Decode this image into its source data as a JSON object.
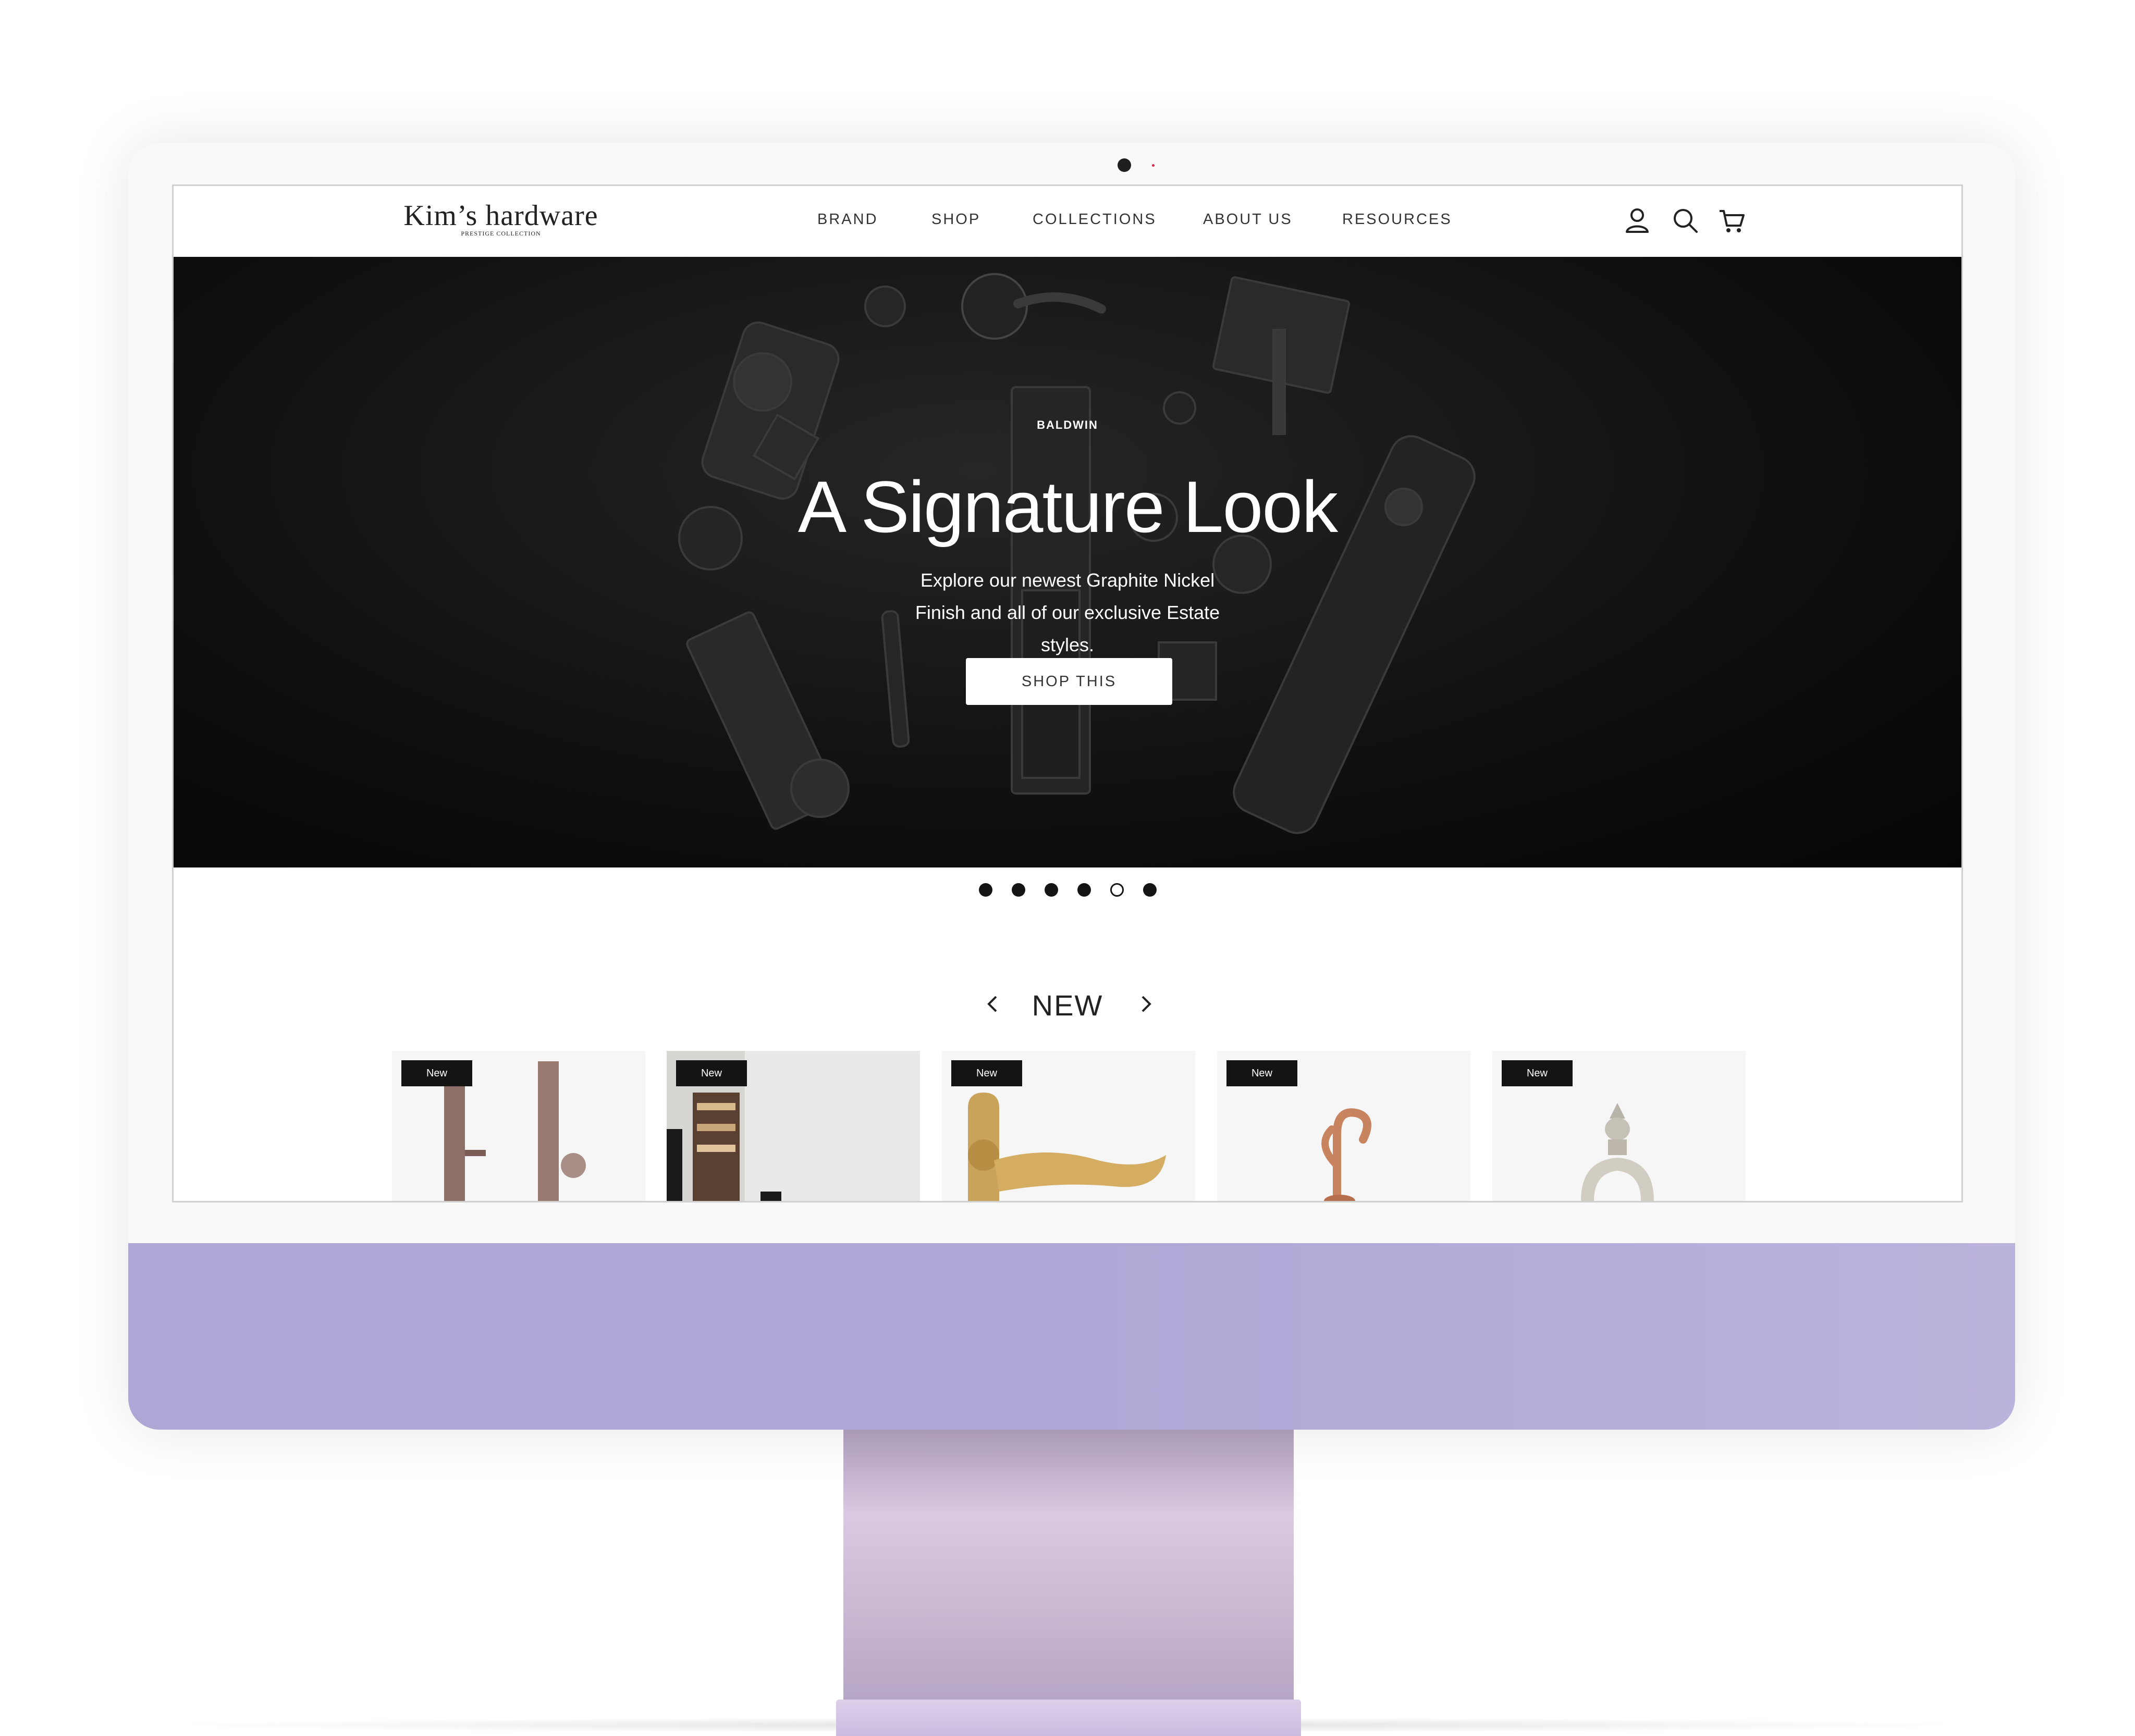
{
  "header": {
    "logo_main": "Kim’s hardware",
    "logo_sub": "PRESTIGE COLLECTION",
    "nav": [
      {
        "label": "BRAND"
      },
      {
        "label": "SHOP"
      },
      {
        "label": "COLLECTIONS"
      },
      {
        "label": "ABOUT US"
      },
      {
        "label": "RESOURCES"
      }
    ],
    "icons": [
      "account-icon",
      "search-icon",
      "cart-icon"
    ]
  },
  "hero": {
    "brand_tag": "BALDWIN",
    "title": "A Signature Look",
    "subtitle_line1": "Explore our newest Graphite Nickel",
    "subtitle_line2": "Finish and all of our exclusive Estate styles.",
    "button_label": "SHOP THIS",
    "slide_count": 6,
    "active_slide": 5
  },
  "new_section": {
    "title": "NEW",
    "products": [
      {
        "badge": "New",
        "image": "entry-handleset-pair"
      },
      {
        "badge": "New",
        "image": "interior-room-shelving"
      },
      {
        "badge": "New",
        "image": "brass-lever-rosette"
      },
      {
        "badge": "New",
        "image": "copper-double-hook"
      },
      {
        "badge": "New",
        "image": "nickel-door-knocker"
      }
    ]
  },
  "colors": {
    "chin": "#aea8d6",
    "hero_bg": "#111111",
    "badge_bg": "#141414"
  }
}
